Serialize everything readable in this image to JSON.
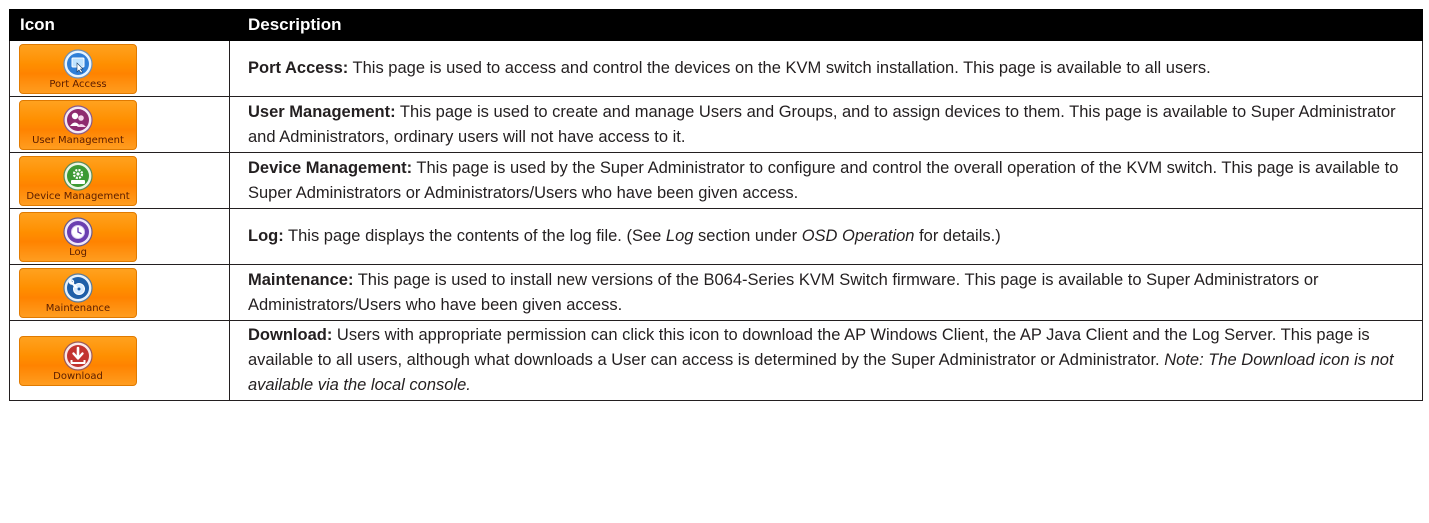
{
  "header": {
    "icon_col": "Icon",
    "desc_col": "Description"
  },
  "rows": [
    {
      "button_label": "Port Access",
      "icon": "port-access-icon",
      "title": "Port Access:",
      "text": " This page is used to access and control the devices on the KVM switch installation. This page is available to all users."
    },
    {
      "button_label": "User Management",
      "icon": "user-management-icon",
      "title": "User Management:",
      "text": " This page is used to create and manage Users and Groups, and to assign devices to them. This page is available to Super Administrator and Administrators, ordinary users will not have access to it."
    },
    {
      "button_label": "Device Management",
      "icon": "device-management-icon",
      "title": "Device Management:",
      "text": " This page is used by the Super Administrator to configure and control the overall operation of the KVM switch. This page is available to Super Administrators or Administrators/Users who have been given access."
    },
    {
      "button_label": "Log",
      "icon": "log-clock-icon",
      "title": "Log:",
      "text_a": " This page displays the contents of the log file. (See ",
      "em_a": "Log",
      "text_b": " section under ",
      "em_b": "OSD Operation",
      "text_c": " for details.)"
    },
    {
      "button_label": "Maintenance",
      "icon": "maintenance-icon",
      "title": "Maintenance:",
      "text": " This page is used to install new versions of the B064-Series KVM Switch firmware. This page is available to Super Administrators or Administrators/Users who have been given access."
    },
    {
      "button_label": "Download",
      "icon": "download-icon",
      "title": "Download:",
      "text": " Users with appropriate permission can click this icon to download the AP Windows Client, the AP Java Client and the Log Server. This page is available to all users, although what downloads a User can access is determined by the Super Administrator or Administrator. ",
      "note": "Note: The Download icon is not available via the local console."
    }
  ],
  "colors": {
    "header_bg": "#000000",
    "button_orange": "#ff8f00",
    "text": "#231f20"
  }
}
